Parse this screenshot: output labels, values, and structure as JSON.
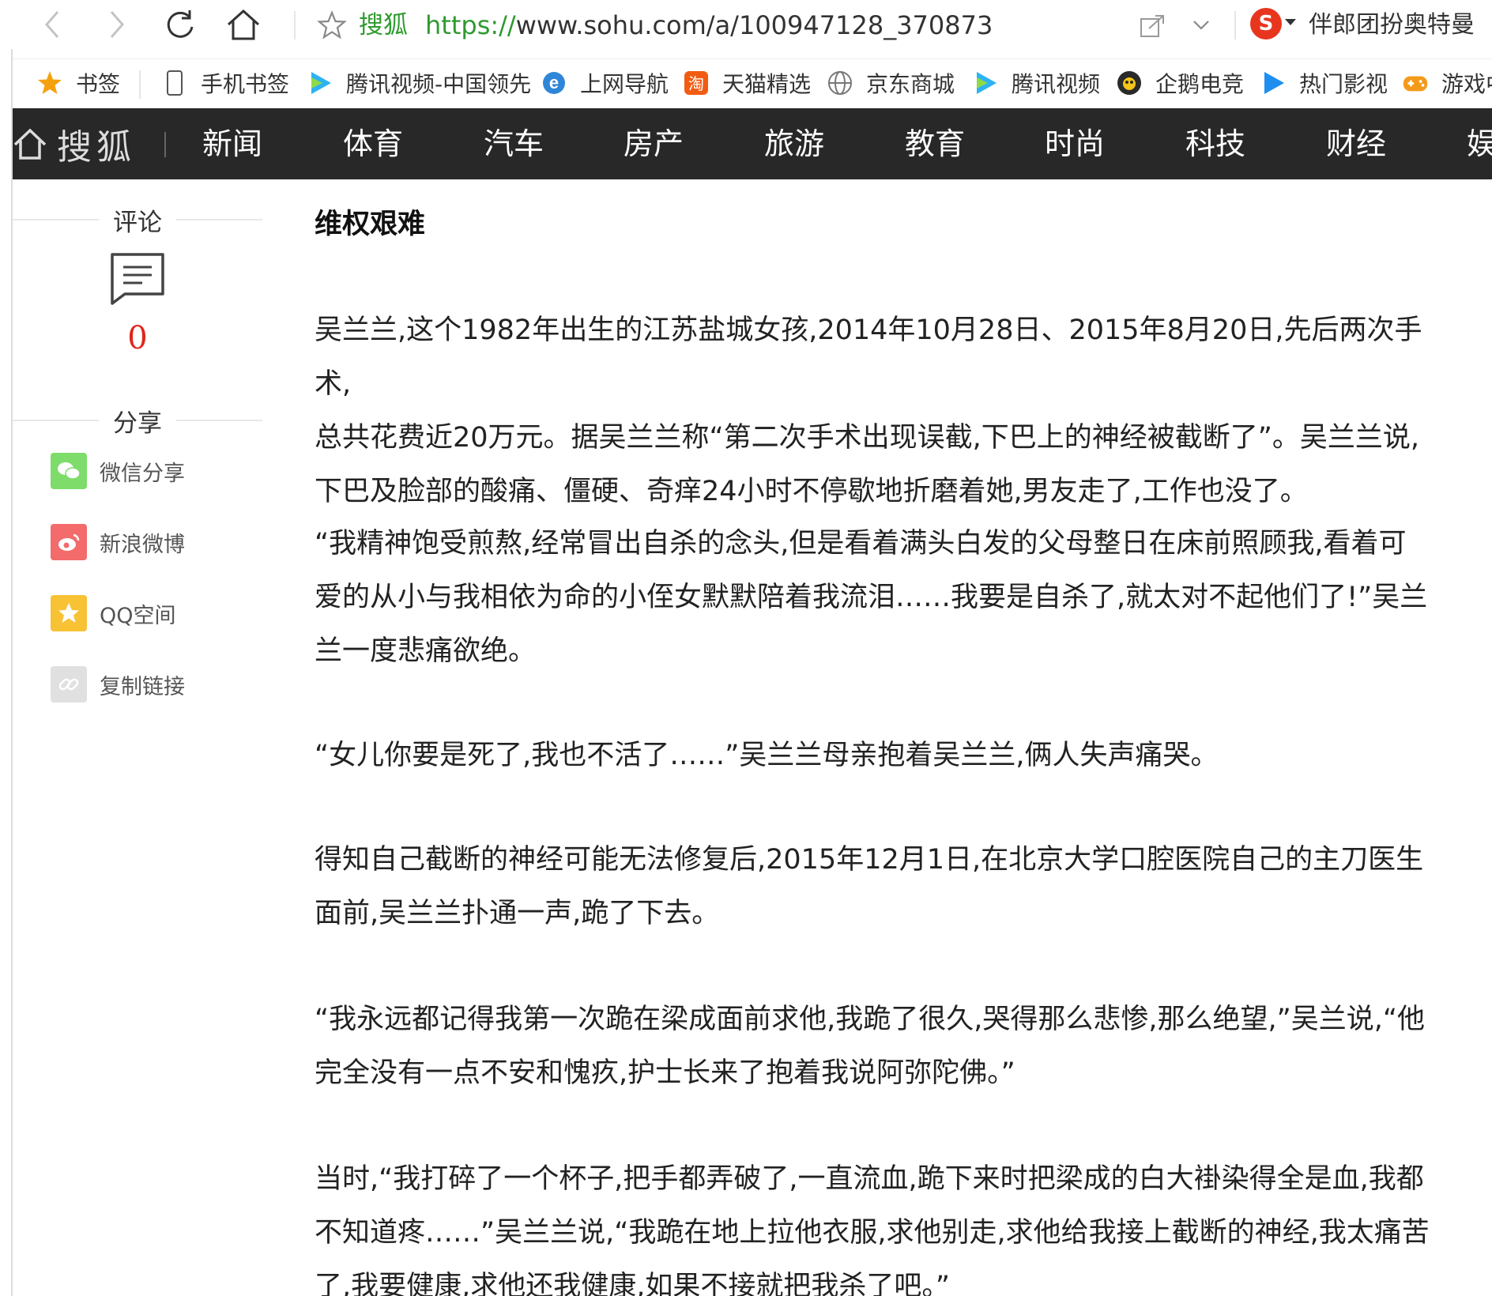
{
  "browser": {
    "site_label": "搜狐",
    "url_scheme": "https://",
    "url_rest": "www.sohu.com/a/100947128_370873",
    "search_text": "伴郎团扮奥特曼"
  },
  "bookmarks": [
    {
      "label": "书签",
      "icon": "star-icon"
    },
    {
      "label": "手机书签",
      "icon": "phone-icon"
    },
    {
      "label": "腾讯视频-中国领先",
      "icon": "play-icon"
    },
    {
      "label": "上网导航",
      "icon": "ie-icon"
    },
    {
      "label": "天猫精选",
      "icon": "taobao-icon"
    },
    {
      "label": "京东商城",
      "icon": "globe-icon"
    },
    {
      "label": "腾讯视频",
      "icon": "play-icon"
    },
    {
      "label": "企鹅电竞",
      "icon": "penguin-icon"
    },
    {
      "label": "热门影视",
      "icon": "play-blue-icon"
    },
    {
      "label": "游戏中",
      "icon": "gamepad-icon"
    }
  ],
  "sohu_nav": {
    "logo": "搜狐",
    "items": [
      "新闻",
      "体育",
      "汽车",
      "房产",
      "旅游",
      "教育",
      "时尚",
      "科技",
      "财经",
      "娱"
    ]
  },
  "rail": {
    "comment_label": "评论",
    "comment_count": "0",
    "share_label": "分享",
    "share_items": [
      {
        "label": "微信分享",
        "color": "#7ddc6a"
      },
      {
        "label": "新浪微博",
        "color": "#f36b6b"
      },
      {
        "label": "QQ空间",
        "color": "#f8c235"
      },
      {
        "label": "复制链接",
        "color": "#e0e0e0"
      }
    ]
  },
  "article": {
    "heading": "维权艰难",
    "paragraphs": [
      [
        "吴兰兰,这个1982年出生的江苏盐城女孩,2014年10月28日、2015年8月20日,先后两次手术,",
        "总共花费近20万元。据吴兰兰称“第二次手术出现误截,下巴上的神经被截断了”。吴兰兰说,",
        "下巴及脸部的酸痛、僵硬、奇痒24小时不停歇地折磨着她,男友走了,工作也没了。"
      ],
      [
        "“我精神饱受煎熬,经常冒出自杀的念头,但是看着满头白发的父母整日在床前照顾我,看着可",
        "爱的从小与我相依为命的小侄女默默陪着我流泪……我要是自杀了,就太对不起他们了!”吴兰",
        "兰一度悲痛欲绝。"
      ],
      [
        "“女儿你要是死了,我也不活了……”吴兰兰母亲抱着吴兰兰,俩人失声痛哭。"
      ],
      [
        "得知自己截断的神经可能无法修复后,2015年12月1日,在北京大学口腔医院自己的主刀医生",
        "面前,吴兰兰扑通一声,跪了下去。"
      ],
      [
        "“我永远都记得我第一次跪在梁成面前求他,我跪了很久,哭得那么悲惨,那么绝望,”吴兰说,“他",
        "完全没有一点不安和愧疚,护士长来了抱着我说阿弥陀佛。”"
      ],
      [
        "当时,“我打碎了一个杯子,把手都弄破了,一直流血,跪下来时把梁成的白大褂染得全是血,我都",
        "不知道疼……”吴兰兰说,“我跪在地上拉他衣服,求他别走,求他给我接上截断的神经,我太痛苦",
        "了,我要健康,求他还我健康,如果不接就把我杀了吧。”"
      ]
    ]
  }
}
